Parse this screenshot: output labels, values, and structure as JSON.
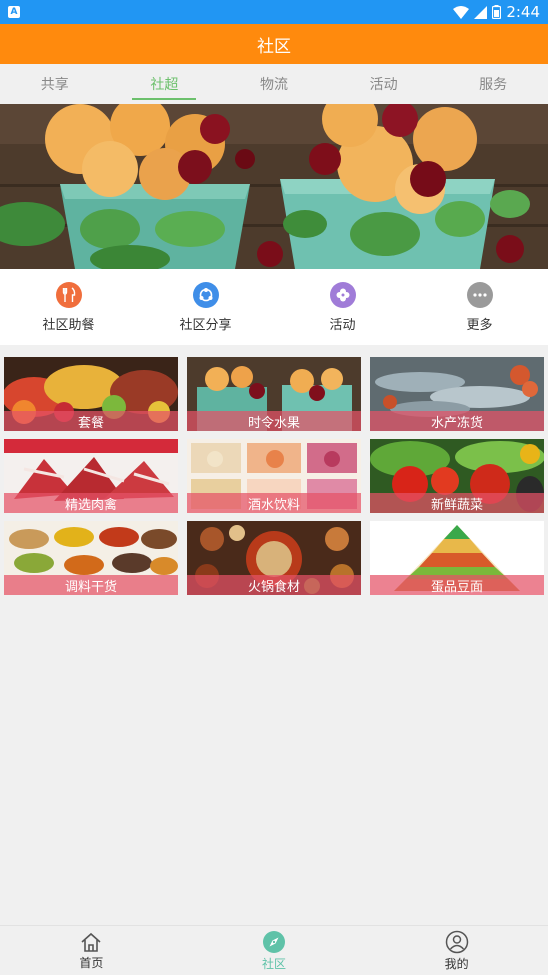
{
  "status_bar": {
    "time": "2:44",
    "notification_letter": "A"
  },
  "title": "社区",
  "tabs": [
    {
      "label": "共享"
    },
    {
      "label": "社超"
    },
    {
      "label": "物流"
    },
    {
      "label": "活动"
    },
    {
      "label": "服务"
    }
  ],
  "quick_menu": [
    {
      "label": "社区助餐",
      "icon": "fork-knife-icon",
      "color": "#f06e3c"
    },
    {
      "label": "社区分享",
      "icon": "share-icon",
      "color": "#3f8ee8"
    },
    {
      "label": "活动",
      "icon": "clover-icon",
      "color": "#a07cd8"
    },
    {
      "label": "更多",
      "icon": "more-dots-icon",
      "color": "#9a9a9a"
    }
  ],
  "categories": [
    {
      "label": "套餐"
    },
    {
      "label": "时令水果"
    },
    {
      "label": "水产冻货"
    },
    {
      "label": "精选肉禽"
    },
    {
      "label": "酒水饮料"
    },
    {
      "label": "新鲜蔬菜"
    },
    {
      "label": "调料干货"
    },
    {
      "label": "火锅食材"
    },
    {
      "label": "蛋品豆面"
    }
  ],
  "bottom_nav": [
    {
      "label": "首页",
      "icon": "home-icon"
    },
    {
      "label": "社区",
      "icon": "compass-icon"
    },
    {
      "label": "我的",
      "icon": "user-icon"
    }
  ],
  "colors": {
    "header": "#ff8a0d",
    "status_bar": "#2196f3",
    "active_tab": "#6cc06c",
    "active_nav": "#5fc2a8",
    "category_label_bg": "#e45266"
  }
}
